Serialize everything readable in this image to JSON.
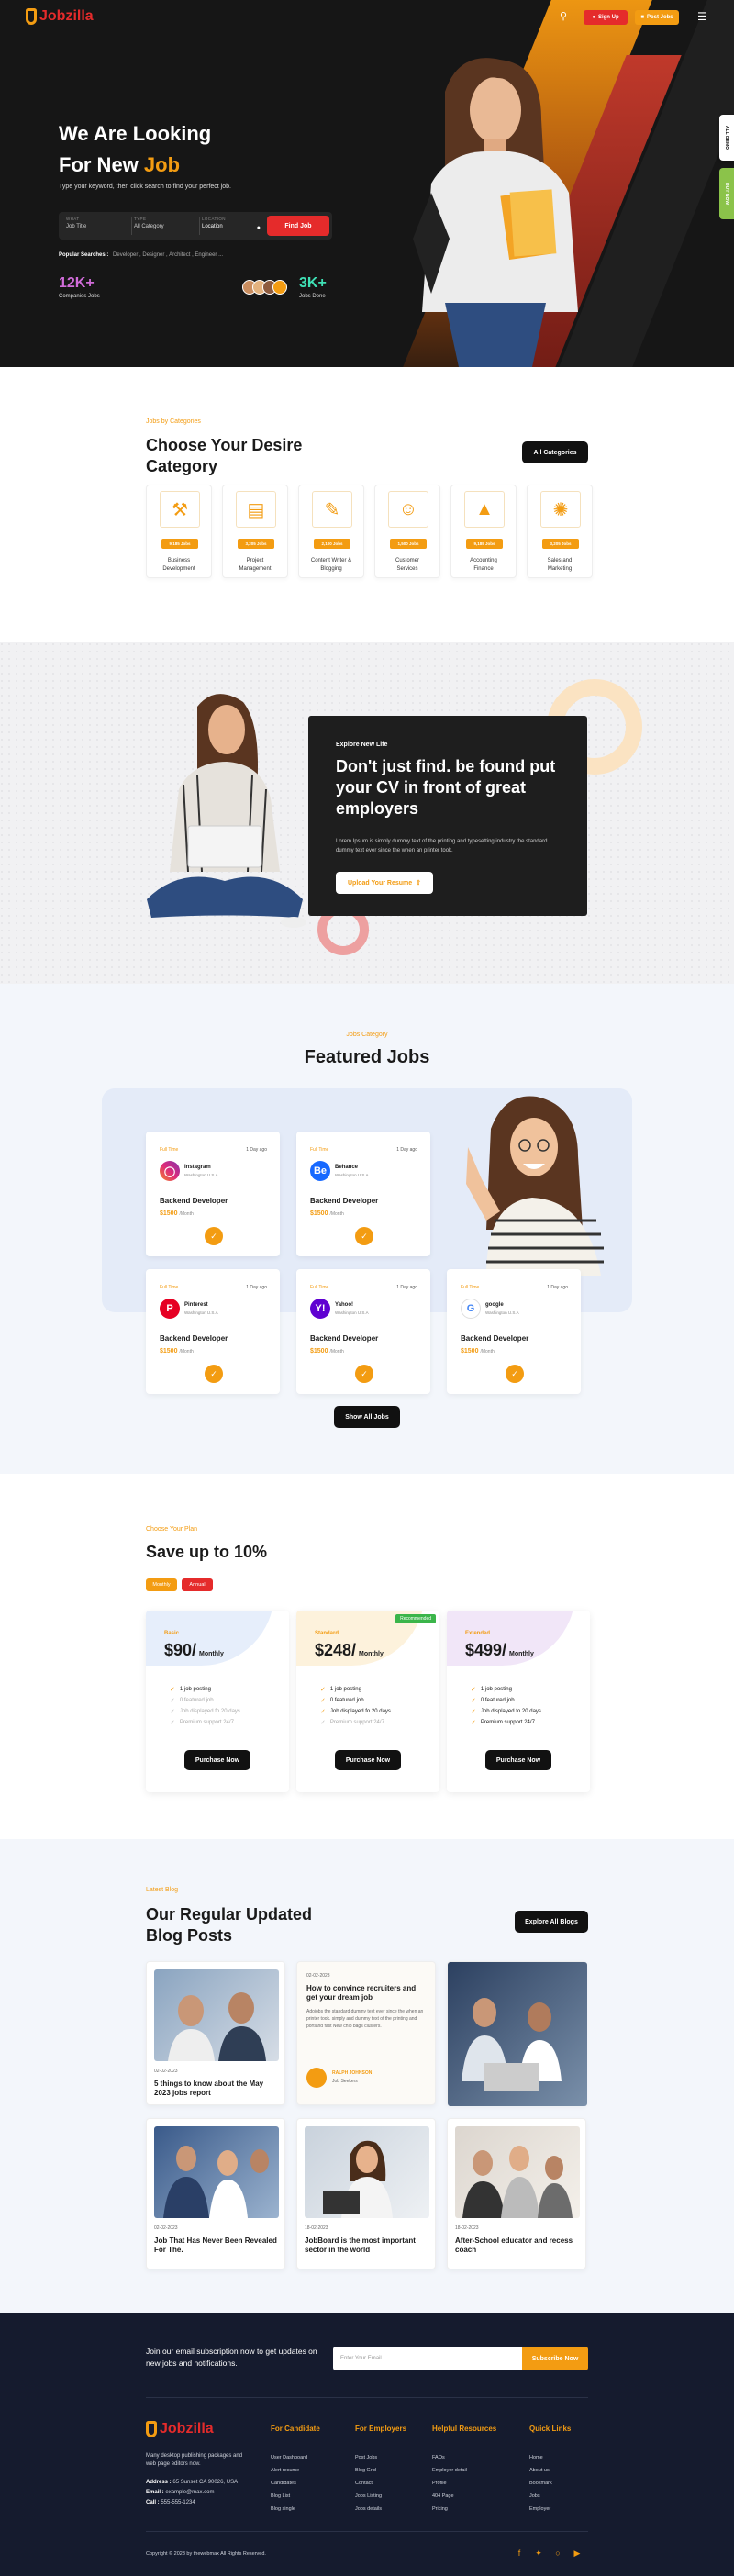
{
  "header": {
    "logo": "Jobzilla",
    "signup": "Sign Up",
    "postjob": "Post Jobs"
  },
  "side_tabs": {
    "all_demo": "ALL DEMO",
    "buy_now": "BUY NOW"
  },
  "hero": {
    "title_line1": "We Are Looking",
    "title_line2_prefix": "For New ",
    "title_line2_accent": "Job",
    "subtitle": "Type your keyword, then click search to find your perfect job.",
    "search": {
      "what_label": "WHAT",
      "what_placeholder": "Job Title",
      "type_label": "TYPE",
      "type_value": "All Category",
      "location_label": "LOCATION",
      "location_value": "Location",
      "button": "Find Job"
    },
    "popular_label": "Popular Searches :",
    "popular_terms": "Developer , Designer , Architect , Engineer ...",
    "stat1_value": "12K+",
    "stat1_label": "Companies Jobs",
    "stat2_value": "3K+",
    "stat2_label": "Jobs Done"
  },
  "categories": {
    "eyebrow": "Jobs by Categories",
    "title_line1": "Choose Your Desire",
    "title_line2": "Category",
    "all_button": "All Categories",
    "items": [
      {
        "badge": "9,185 Jobs",
        "name_line1": "Business",
        "name_line2": "Development"
      },
      {
        "badge": "3,205 Jobs",
        "name_line1": "Project",
        "name_line2": "Management"
      },
      {
        "badge": "2,100 Jobs",
        "name_line1": "Content Writer &",
        "name_line2": "Blogging"
      },
      {
        "badge": "1,500 Jobs",
        "name_line1": "Customer",
        "name_line2": "Services"
      },
      {
        "badge": "9,185 Jobs",
        "name_line1": "Accounting",
        "name_line2": "Finance"
      },
      {
        "badge": "3,205 Jobs",
        "name_line1": "Sales and",
        "name_line2": "Marketing"
      }
    ]
  },
  "explore": {
    "eyebrow": "Explore New Life",
    "title": "Don't just find. be found put your CV in front of great employers",
    "body": "Lorem Ipsum is simply dummy text of the printing and typesetting industry the standard dummy text ever since the when an printer took.",
    "button": "Upload Your Resume"
  },
  "featured": {
    "eyebrow": "Jobs Category",
    "title": "Featured Jobs",
    "show_all": "Show All Jobs",
    "jobs": [
      {
        "type": "Full Time",
        "date": "1 Day ago",
        "company": "Instagram",
        "location": "Washington U.S.A",
        "title": "Backend Developer",
        "salary": "$1500",
        "period": "/Month"
      },
      {
        "type": "Full Time",
        "date": "1 Day ago",
        "company": "Behance",
        "location": "Washington U.S.A",
        "title": "Backend Developer",
        "salary": "$1500",
        "period": "/Month"
      },
      {
        "type": "Full Time",
        "date": "1 Day ago",
        "company": "Pinterest",
        "location": "Washington U.S.A",
        "title": "Backend Developer",
        "salary": "$1500",
        "period": "/Month"
      },
      {
        "type": "Full Time",
        "date": "1 Day ago",
        "company": "Yahoo!",
        "location": "Washington U.S.A",
        "title": "Backend Developer",
        "salary": "$1500",
        "period": "/Month"
      },
      {
        "type": "Full Time",
        "date": "1 Day ago",
        "company": "google",
        "location": "Washington U.S.A",
        "title": "Backend Developer",
        "salary": "$1500",
        "period": "/Month"
      }
    ]
  },
  "plans": {
    "eyebrow": "Choose Your Plan",
    "title": "Save up to 10%",
    "toggle_monthly": "Monthly",
    "toggle_annual": "Annual",
    "recommended": "Recommended",
    "buy": "Purchase Now",
    "items": [
      {
        "name": "Basic",
        "price": "$90/",
        "period": "Monthly",
        "features": [
          "1 job posting",
          "0 featured job",
          "Job displayed fo 20 days",
          "Premium support 24/7"
        ],
        "enabled": [
          true,
          false,
          false,
          false
        ]
      },
      {
        "name": "Standard",
        "price": "$248/",
        "period": "Monthly",
        "features": [
          "1 job posting",
          "0 featured job",
          "Job displayed fo 20 days",
          "Premium support 24/7"
        ],
        "enabled": [
          true,
          true,
          true,
          false
        ]
      },
      {
        "name": "Extended",
        "price": "$499/",
        "period": "Monthly",
        "features": [
          "1 job posting",
          "0 featured job",
          "Job displayed fo 20 days",
          "Premium support 24/7"
        ],
        "enabled": [
          true,
          true,
          true,
          true
        ]
      }
    ]
  },
  "blog": {
    "eyebrow": "Latest Blog",
    "title_line1": "Our Regular Updated",
    "title_line2": "Blog Posts",
    "explore_button": "Explore All Blogs",
    "posts": [
      {
        "date": "02-02-2023",
        "title": "5 things to know about the May 2023 jobs report"
      },
      {
        "date": "02-02-2023",
        "title": "How to convince recruiters and get your dream job",
        "excerpt": "Adojobs the standard dummy text ever since the when an printer took. simply and dummy text of the printing and portland fast New chip bags clusters.",
        "author": "RALPH JOHNSON",
        "author_role": "Job Seekers"
      },
      {
        "date": "02-02-2023",
        "title": "Job That Has Never Been Revealed For The."
      },
      {
        "date": "18-02-2023",
        "title": "JobBoard is the most important sector in the world"
      },
      {
        "date": "18-02-2023",
        "title": "After-School educator and recess coach"
      }
    ]
  },
  "footer": {
    "subscribe_text": "Join our email subscription now to get updates on new jobs and notifications.",
    "email_placeholder": "Enter Your Email",
    "subscribe_button": "Subscribe Now",
    "logo": "Jobzilla",
    "about": "Many desktop publishing packages and web page editors now.",
    "address_label": "Address :",
    "address": "65 Sunset CA 90026, USA",
    "email_label": "Email :",
    "email": "example@max.com",
    "call_label": "Call :",
    "call": "555-555-1234",
    "columns": [
      {
        "title": "For Candidate",
        "links": [
          "User Dashboard",
          "Alert resume",
          "Candidates",
          "Blog List",
          "Blog single"
        ]
      },
      {
        "title": "For Employers",
        "links": [
          "Post Jobs",
          "Blog Grid",
          "Contact",
          "Jobs Listing",
          "Jobs details"
        ]
      },
      {
        "title": "Helpful Resources",
        "links": [
          "FAQs",
          "Employer detail",
          "Profile",
          "404 Page",
          "Pricing"
        ]
      },
      {
        "title": "Quick Links",
        "links": [
          "Home",
          "About us",
          "Bookmark",
          "Jobs",
          "Employer"
        ]
      }
    ],
    "copyright": "Copyright © 2023 by thewebmax All Rights Reserved."
  },
  "colors": {
    "accent": "#f39c12",
    "brand_red": "#e52b2b",
    "dark": "#161616",
    "footer": "#151b2e",
    "buy_green": "#8bc34a"
  }
}
